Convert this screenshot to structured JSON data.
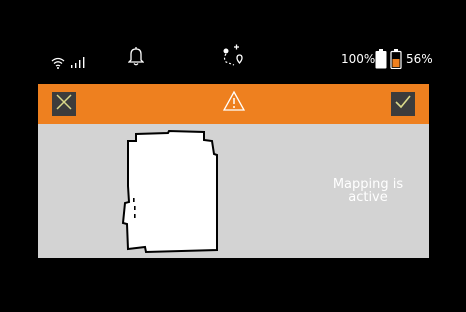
{
  "status_bar": {
    "wifi_icon": "wifi-icon",
    "signal_icon": "signal-bars-icon",
    "notification_icon": "bell-icon",
    "route_icon": "route-pin-icon",
    "device_battery_percent": "100%",
    "robot_battery_percent": "56%"
  },
  "header": {
    "accent_color": "#ee801f",
    "cancel_icon": "close-icon",
    "warning_icon": "warning-triangle-icon",
    "confirm_icon": "checkmark-icon"
  },
  "content": {
    "panel_color": "#d3d3d3",
    "status_line1": "Mapping is",
    "status_line2": "active"
  }
}
